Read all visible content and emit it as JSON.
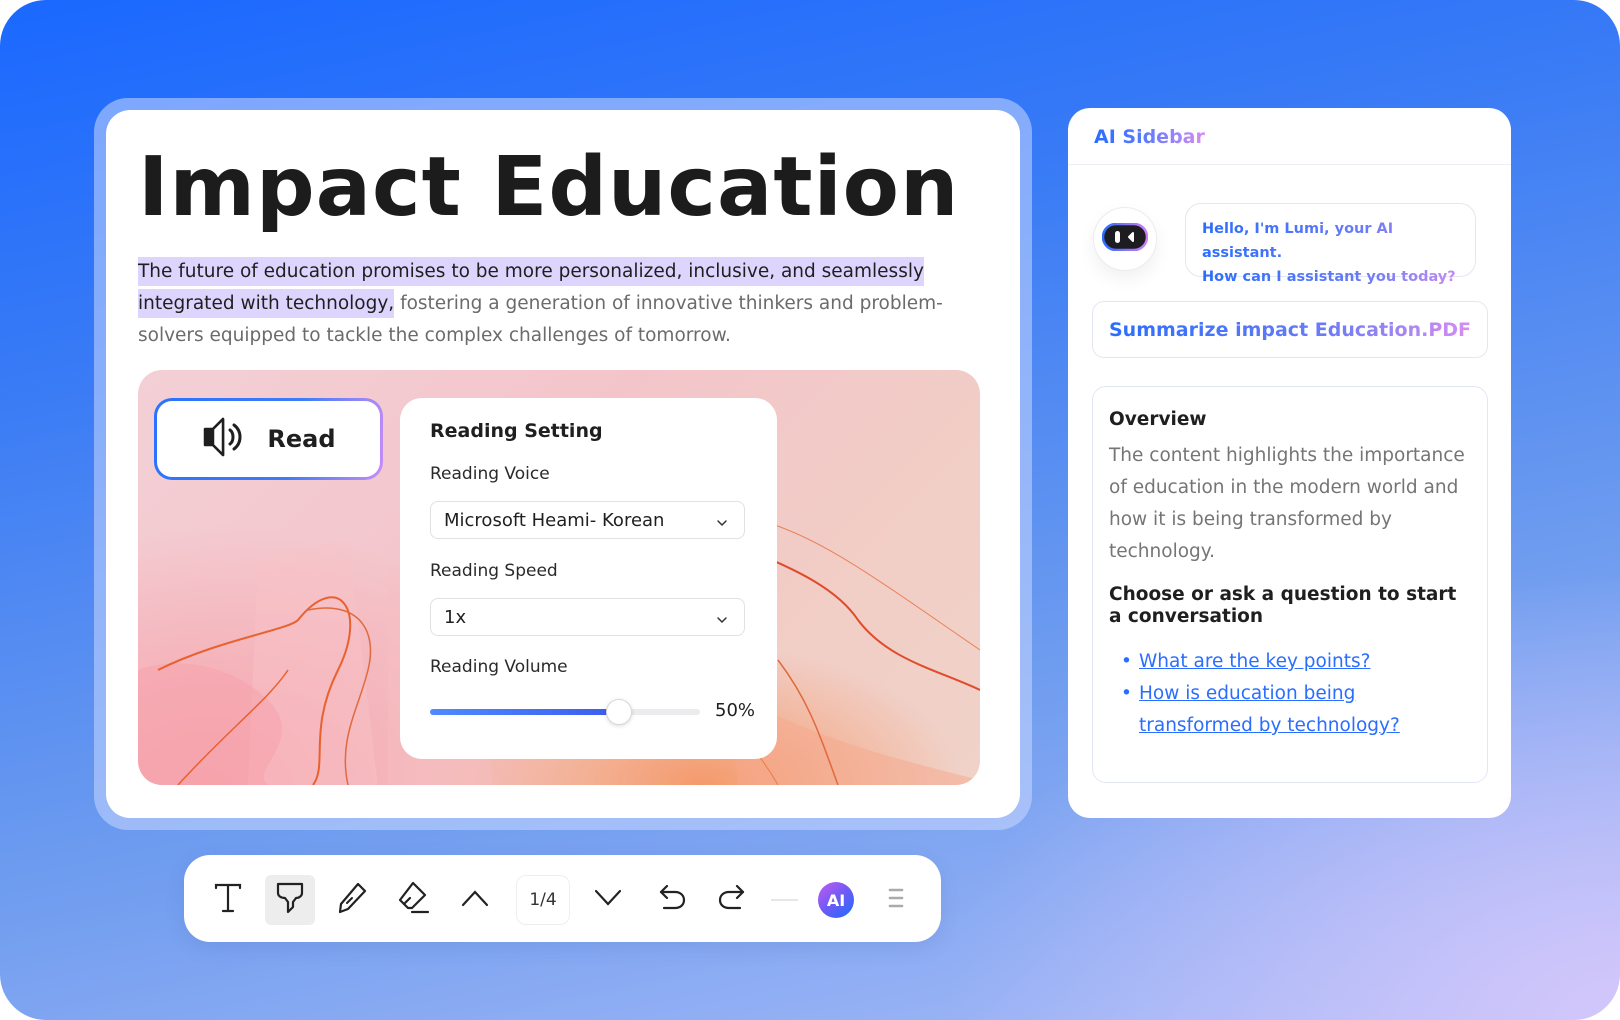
{
  "document": {
    "title": "Impact Education",
    "body_highlighted": "The future of education promises to be more personalized, inclusive, and seamlessly integrated with technology,",
    "body_rest": " fostering a generation of innovative thinkers and problem-solvers equipped to tackle the complex challenges of tomorrow.",
    "highlight_color": "#ddd5fd"
  },
  "read_button": {
    "label": "Read",
    "icon": "speaker-icon"
  },
  "reading_settings": {
    "title": "Reading Setting",
    "voice_label": "Reading Voice",
    "voice_value": "Microsoft Heami- Korean",
    "speed_label": "Reading Speed",
    "speed_value": "1x",
    "volume_label": "Reading Volume",
    "volume_percent": 50,
    "volume_text": "50%",
    "accent_color": "#3b6cf5"
  },
  "ai_sidebar": {
    "title": "AI Sidebar",
    "avatar_icon": "robot-face-icon",
    "greeting_line1": "Hello, I'm Lumi, your AI assistant.",
    "greeting_line2": "How can I assistant you today?",
    "summarize_label": "Summarize impact Education.PDF",
    "overview": {
      "title": "Overview",
      "body": "The content highlights the importance of education in the modern world and how it is being transformed by technology.",
      "prompt": "Choose or ask a question to start a conversation",
      "questions": [
        "What are the key points?",
        "How is education being transformed by technology?"
      ]
    },
    "link_color": "#2a6dff"
  },
  "toolbar": {
    "tools": [
      {
        "name": "text-tool",
        "icon": "text-icon",
        "active": false
      },
      {
        "name": "highlighter-tool",
        "icon": "highlighter-icon",
        "active": true
      },
      {
        "name": "pen-tool",
        "icon": "pencil-icon",
        "active": false
      },
      {
        "name": "eraser-tool",
        "icon": "eraser-icon",
        "active": false
      }
    ],
    "page_indicator": "1/4",
    "ai_label": "AI"
  }
}
